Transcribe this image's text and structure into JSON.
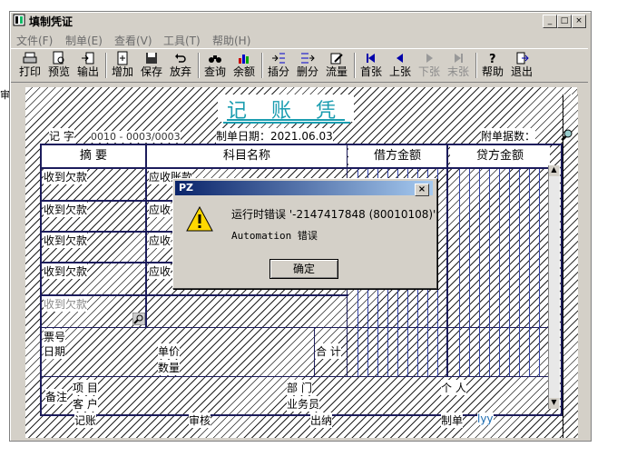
{
  "window": {
    "title": "填制凭证"
  },
  "menu": [
    "文件(F)",
    "制单(E)",
    "查看(V)",
    "工具(T)",
    "帮助(H)"
  ],
  "toolbar": {
    "print": "打印",
    "preview": "预览",
    "export": "输出",
    "add": "增加",
    "save": "保存",
    "abandon": "放弃",
    "query": "查询",
    "balance": "余额",
    "insert": "插分",
    "delete": "删分",
    "flow": "流量",
    "first": "首张",
    "prev": "上张",
    "next": "下张",
    "last": "末张",
    "help": "帮助",
    "exit": "退出"
  },
  "voucher": {
    "title": "记 账 凭 证",
    "type_label": "记 字",
    "number": "0010 - 0003/0003",
    "date": "制单日期：2021.06.03",
    "attachments": "附单据数：",
    "headers": {
      "summary": "摘 要",
      "account": "科目名称",
      "debit": "借方金额",
      "credit": "贷方金额"
    },
    "rows": [
      {
        "summary": "收到欠款",
        "account": "应收账款"
      },
      {
        "summary": "收到欠款",
        "account": "应收"
      },
      {
        "summary": "收到欠款",
        "account": "应收"
      },
      {
        "summary": "收到欠款",
        "account": "应收"
      },
      {
        "summary": "收到欠款",
        "account": ""
      }
    ],
    "ticket_no": "票号",
    "date_label": "日期",
    "unit_price": "单价",
    "quantity": "数量",
    "total": "合 计",
    "remark": "备注",
    "project": "项 目",
    "department": "部 门",
    "person": "个 人",
    "customer": "客 户",
    "salesperson": "业务员"
  },
  "footer": {
    "bookkeeper": "记账",
    "auditor": "审核",
    "cashier": "出纳",
    "maker": "制单",
    "maker_name": "lyy"
  },
  "dialog": {
    "title": "PZ",
    "message": "运行时错误 '-2147417848 (80010108)':",
    "detail": "Automation 错误",
    "ok": "确定"
  },
  "side_label": "审"
}
